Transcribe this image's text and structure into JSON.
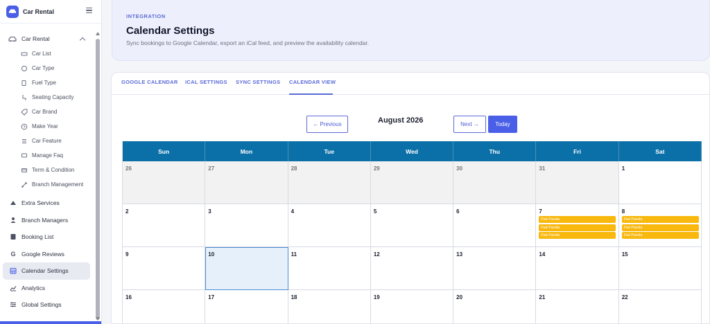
{
  "brand": {
    "name": "Car Rental",
    "logo_icon": "car-icon",
    "accent": "#4a5fe8"
  },
  "sidebar": {
    "group": {
      "label": "Car Rental",
      "icon": "car-icon"
    },
    "sub_items": [
      {
        "label": "Car List",
        "icon": "car-list-icon"
      },
      {
        "label": "Car Type",
        "icon": "car-type-icon"
      },
      {
        "label": "Fuel Type",
        "icon": "fuel-icon"
      },
      {
        "label": "Seating Capacity",
        "icon": "seat-icon"
      },
      {
        "label": "Car Brand",
        "icon": "brand-icon"
      },
      {
        "label": "Make Year",
        "icon": "clock-icon"
      },
      {
        "label": "Car Feature",
        "icon": "feature-icon"
      },
      {
        "label": "Manage Faq",
        "icon": "faq-icon"
      },
      {
        "label": "Term & Condition",
        "icon": "document-icon"
      },
      {
        "label": "Branch Management",
        "icon": "branch-icon"
      }
    ],
    "main_items": [
      {
        "label": "Extra Services",
        "icon": "services-icon"
      },
      {
        "label": "Branch Managers",
        "icon": "user-icon"
      },
      {
        "label": "Booking List",
        "icon": "booking-icon"
      },
      {
        "label": "Google Reviews",
        "icon": "google-icon"
      },
      {
        "label": "Calendar Settings",
        "icon": "calendar-icon",
        "active": true
      },
      {
        "label": "Analytics",
        "icon": "analytics-icon"
      },
      {
        "label": "Global Settings",
        "icon": "settings-icon"
      }
    ]
  },
  "header": {
    "eyebrow": "INTEGRATION",
    "title": "Calendar Settings",
    "subtitle": "Sync bookings to Google Calendar, export an iCal feed, and preview the availability calendar."
  },
  "tabs": [
    {
      "label": "GOOGLE CALENDAR"
    },
    {
      "label": "ICAL SETTINGS"
    },
    {
      "label": "SYNC SETTINGS"
    },
    {
      "label": "CALENDAR VIEW",
      "active": true
    }
  ],
  "calendar": {
    "prev_label": "← Previous",
    "next_label": "Next →",
    "today_label": "Today",
    "month_label": "August 2026",
    "weekdays": [
      "Sun",
      "Mon",
      "Tue",
      "Wed",
      "Thu",
      "Fri",
      "Sat"
    ],
    "header_color": "#0b70a8",
    "event_color": "#f8b80e",
    "weeks": [
      [
        {
          "day": "26",
          "other": true
        },
        {
          "day": "27",
          "other": true
        },
        {
          "day": "28",
          "other": true
        },
        {
          "day": "29",
          "other": true
        },
        {
          "day": "30",
          "other": true
        },
        {
          "day": "31",
          "other": true
        },
        {
          "day": "1"
        }
      ],
      [
        {
          "day": "2"
        },
        {
          "day": "3"
        },
        {
          "day": "4"
        },
        {
          "day": "5"
        },
        {
          "day": "6"
        },
        {
          "day": "7",
          "events": [
            "Fiat Panda",
            "Fiat Panda",
            "Fiat Panda"
          ]
        },
        {
          "day": "8",
          "events": [
            "Fiat Panda",
            "Fiat Panda",
            "Fiat Panda"
          ]
        }
      ],
      [
        {
          "day": "9"
        },
        {
          "day": "10",
          "today": true
        },
        {
          "day": "11"
        },
        {
          "day": "12"
        },
        {
          "day": "13"
        },
        {
          "day": "14"
        },
        {
          "day": "15"
        }
      ],
      [
        {
          "day": "16"
        },
        {
          "day": "17"
        },
        {
          "day": "18"
        },
        {
          "day": "19"
        },
        {
          "day": "20"
        },
        {
          "day": "21"
        },
        {
          "day": "22"
        }
      ]
    ]
  }
}
